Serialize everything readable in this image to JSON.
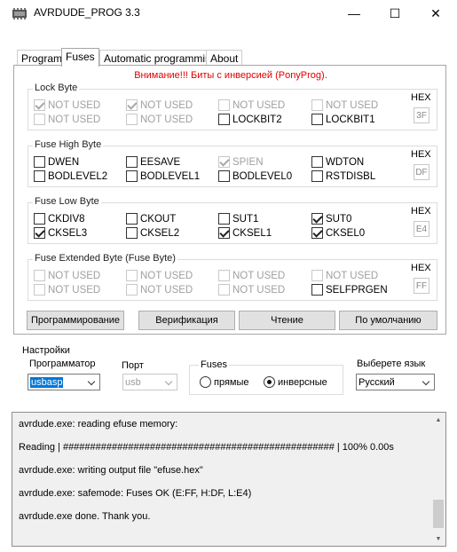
{
  "window": {
    "title": "AVRDUDE_PROG 3.3",
    "min": "—",
    "max": "☐",
    "close": "✕"
  },
  "tabs": [
    {
      "label": "Program"
    },
    {
      "label": "Fuses"
    },
    {
      "label": "Automatic programming"
    },
    {
      "label": "About"
    }
  ],
  "warning": "Внимание!!! Биты с инверсией (PonyProg).",
  "lock_byte": {
    "title": "Lock Byte",
    "hex_label": "HEX",
    "hex": "3F",
    "bits": [
      {
        "label": "NOT USED",
        "checked": true,
        "disabled": true
      },
      {
        "label": "NOT USED",
        "checked": true,
        "disabled": true
      },
      {
        "label": "NOT USED",
        "checked": false,
        "disabled": true
      },
      {
        "label": "NOT USED",
        "checked": false,
        "disabled": true
      },
      {
        "label": "NOT USED",
        "checked": false,
        "disabled": true
      },
      {
        "label": "NOT USED",
        "checked": false,
        "disabled": true
      },
      {
        "label": "LOCKBIT2",
        "checked": false,
        "disabled": false
      },
      {
        "label": "LOCKBIT1",
        "checked": false,
        "disabled": false
      }
    ]
  },
  "fuse_high": {
    "title": "Fuse High Byte",
    "hex_label": "HEX",
    "hex": "DF",
    "bits": [
      {
        "label": "DWEN",
        "checked": false,
        "disabled": false
      },
      {
        "label": "EESAVE",
        "checked": false,
        "disabled": false
      },
      {
        "label": "SPIEN",
        "checked": true,
        "disabled": true
      },
      {
        "label": "WDTON",
        "checked": false,
        "disabled": false
      },
      {
        "label": "BODLEVEL2",
        "checked": false,
        "disabled": false
      },
      {
        "label": "BODLEVEL1",
        "checked": false,
        "disabled": false
      },
      {
        "label": "BODLEVEL0",
        "checked": false,
        "disabled": false
      },
      {
        "label": "RSTDISBL",
        "checked": false,
        "disabled": false
      }
    ]
  },
  "fuse_low": {
    "title": "Fuse Low Byte",
    "hex_label": "HEX",
    "hex": "E4",
    "bits": [
      {
        "label": "CKDIV8",
        "checked": false,
        "disabled": false
      },
      {
        "label": "CKOUT",
        "checked": false,
        "disabled": false
      },
      {
        "label": "SUT1",
        "checked": false,
        "disabled": false
      },
      {
        "label": "SUT0",
        "checked": true,
        "disabled": false
      },
      {
        "label": "CKSEL3",
        "checked": true,
        "disabled": false
      },
      {
        "label": "CKSEL2",
        "checked": false,
        "disabled": false
      },
      {
        "label": "CKSEL1",
        "checked": true,
        "disabled": false
      },
      {
        "label": "CKSEL0",
        "checked": true,
        "disabled": false
      }
    ]
  },
  "fuse_ext": {
    "title": "Fuse Extended Byte (Fuse Byte)",
    "hex_label": "HEX",
    "hex": "FF",
    "bits": [
      {
        "label": "NOT USED",
        "checked": false,
        "disabled": true
      },
      {
        "label": "NOT USED",
        "checked": false,
        "disabled": true
      },
      {
        "label": "NOT USED",
        "checked": false,
        "disabled": true
      },
      {
        "label": "NOT USED",
        "checked": false,
        "disabled": true
      },
      {
        "label": "NOT USED",
        "checked": false,
        "disabled": true
      },
      {
        "label": "NOT USED",
        "checked": false,
        "disabled": true
      },
      {
        "label": "NOT USED",
        "checked": false,
        "disabled": true
      },
      {
        "label": "SELFPRGEN",
        "checked": false,
        "disabled": false
      }
    ]
  },
  "actions": {
    "program": "Программирование",
    "verify": "Верификация",
    "read": "Чтение",
    "default": "По умолчанию"
  },
  "settings": {
    "title": "Настройки",
    "programmer_label": "Программатор",
    "programmer_value": "usbasp",
    "port_label": "Порт",
    "port_value": "usb",
    "fuses_label": "Fuses",
    "radio_direct": "прямые",
    "radio_inverse": "инверсные",
    "fuses_mode": "inverse",
    "lang_label": "Выберете язык",
    "lang_value": "Русский"
  },
  "log": [
    "avrdude.exe: reading efuse memory:",
    "Reading | ################################################## | 100% 0.00s",
    "avrdude.exe: writing output file \"efuse.hex\"",
    "avrdude.exe: safemode: Fuses OK (E:FF, H:DF, L:E4)",
    "avrdude.exe done.  Thank you."
  ],
  "scroll": {
    "up": "▲",
    "down": "▼"
  }
}
